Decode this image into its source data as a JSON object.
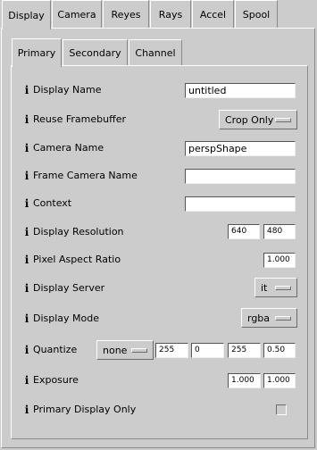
{
  "outer_tabs": [
    "Display",
    "Camera",
    "Reyes",
    "Rays",
    "Accel",
    "Spool"
  ],
  "inner_tabs": [
    "Primary",
    "Secondary",
    "Channel"
  ],
  "rows": {
    "display_name": {
      "label": "Display Name",
      "value": "untitled"
    },
    "reuse_framebuffer": {
      "label": "Reuse Framebuffer",
      "value": "Crop Only"
    },
    "camera_name": {
      "label": "Camera Name",
      "value": "perspShape"
    },
    "frame_camera_name": {
      "label": "Frame Camera Name",
      "value": ""
    },
    "context": {
      "label": "Context",
      "value": ""
    },
    "display_resolution": {
      "label": "Display Resolution",
      "width": "640",
      "height": "480"
    },
    "pixel_aspect_ratio": {
      "label": "Pixel Aspect Ratio",
      "value": "1.000"
    },
    "display_server": {
      "label": "Display Server",
      "value": "it"
    },
    "display_mode": {
      "label": "Display Mode",
      "value": "rgba"
    },
    "quantize": {
      "label": "Quantize",
      "mode": "none",
      "values": [
        "255",
        "0",
        "255",
        "0.50"
      ]
    },
    "exposure": {
      "label": "Exposure",
      "values": [
        "1.000",
        "1.000"
      ]
    },
    "primary_display_only": {
      "label": "Primary Display Only",
      "checked": false
    }
  },
  "icons": {
    "info": "info-icon"
  }
}
